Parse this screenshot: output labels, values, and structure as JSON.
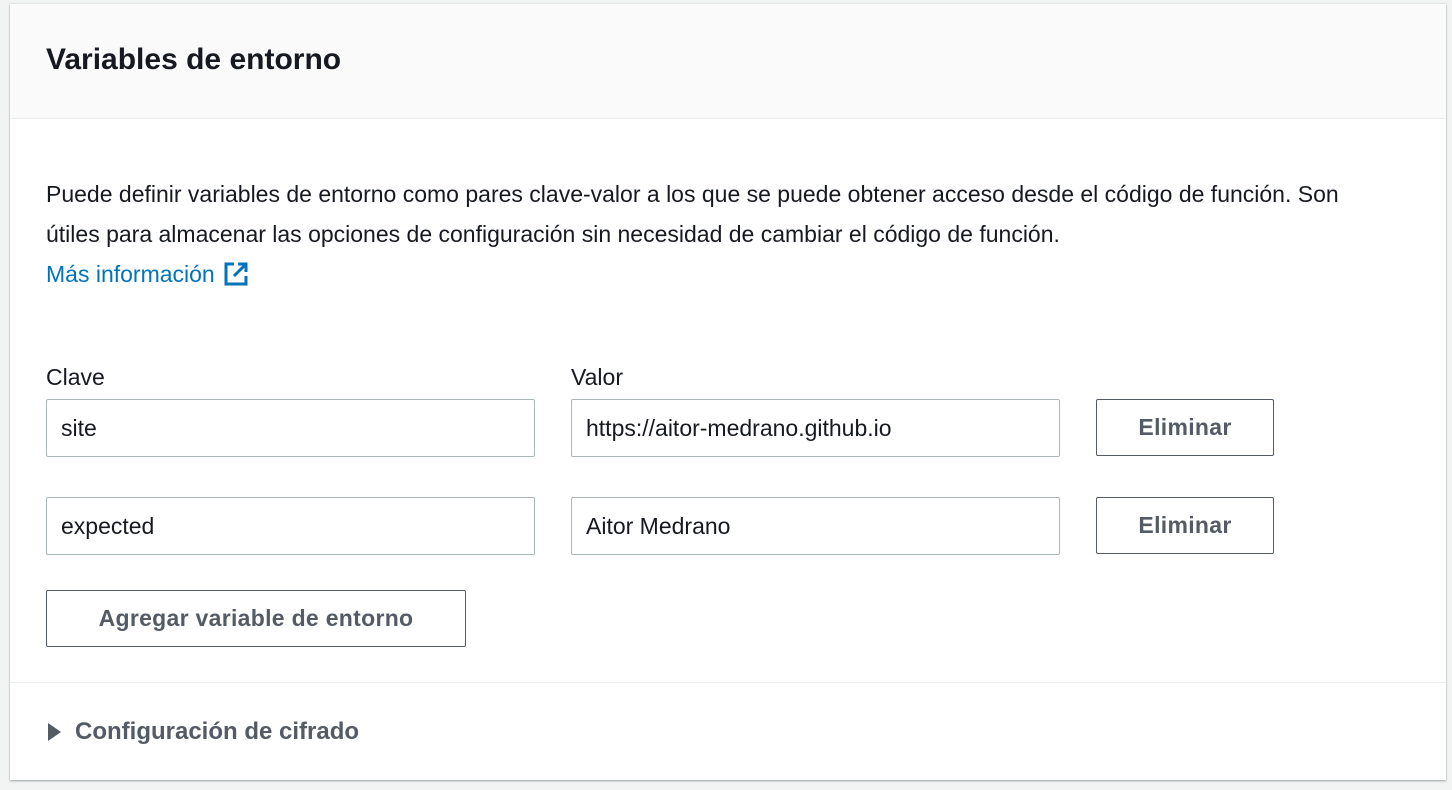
{
  "panel": {
    "title": "Variables de entorno",
    "description": "Puede definir variables de entorno como pares clave-valor a los que se puede obtener acceso desde el código de función. Son útiles para almacenar las opciones de configuración sin necesidad de cambiar el código de función.",
    "learn_more": "Más información",
    "learn_more_icon": "external-link-icon",
    "link_color": "#0073bb"
  },
  "columns": {
    "key_label": "Clave",
    "value_label": "Valor"
  },
  "variables": [
    {
      "key": "site",
      "value": "https://aitor-medrano.github.io",
      "remove_label": "Eliminar"
    },
    {
      "key": "expected",
      "value": "Aitor Medrano",
      "remove_label": "Eliminar"
    }
  ],
  "add_button_label": "Agregar variable de entorno",
  "encryption": {
    "label": "Configuración de cifrado",
    "expanded": false,
    "icon": "caret-right-icon"
  }
}
